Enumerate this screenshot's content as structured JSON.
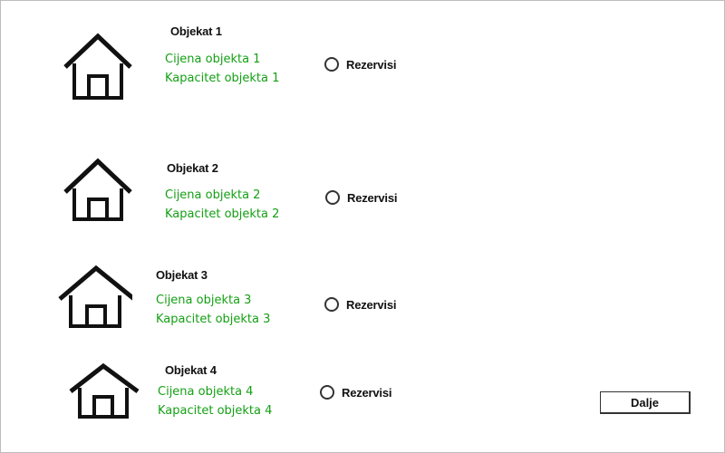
{
  "objects": [
    {
      "title": "Objekat 1",
      "price": "Cijena objekta 1",
      "capacity": "Kapacitet objekta 1",
      "reserve_label": "Rezervisi",
      "icon": "house-icon"
    },
    {
      "title": "Objekat 2",
      "price": "Cijena objekta 2",
      "capacity": "Kapacitet objekta 2",
      "reserve_label": "Rezervisi",
      "icon": "house-icon"
    },
    {
      "title": "Objekat 3",
      "price": "Cijena objekta 3",
      "capacity": "Kapacitet objekta 3",
      "reserve_label": "Rezervisi",
      "icon": "house-icon"
    },
    {
      "title": "Objekat 4",
      "price": "Cijena objekta 4",
      "capacity": "Kapacitet objekta 4",
      "reserve_label": "Rezervisi",
      "icon": "house-icon"
    }
  ],
  "next_button": {
    "label": "Dalje"
  },
  "colors": {
    "info_text": "#14a014",
    "text": "#111111",
    "border": "#bdbdbd"
  }
}
